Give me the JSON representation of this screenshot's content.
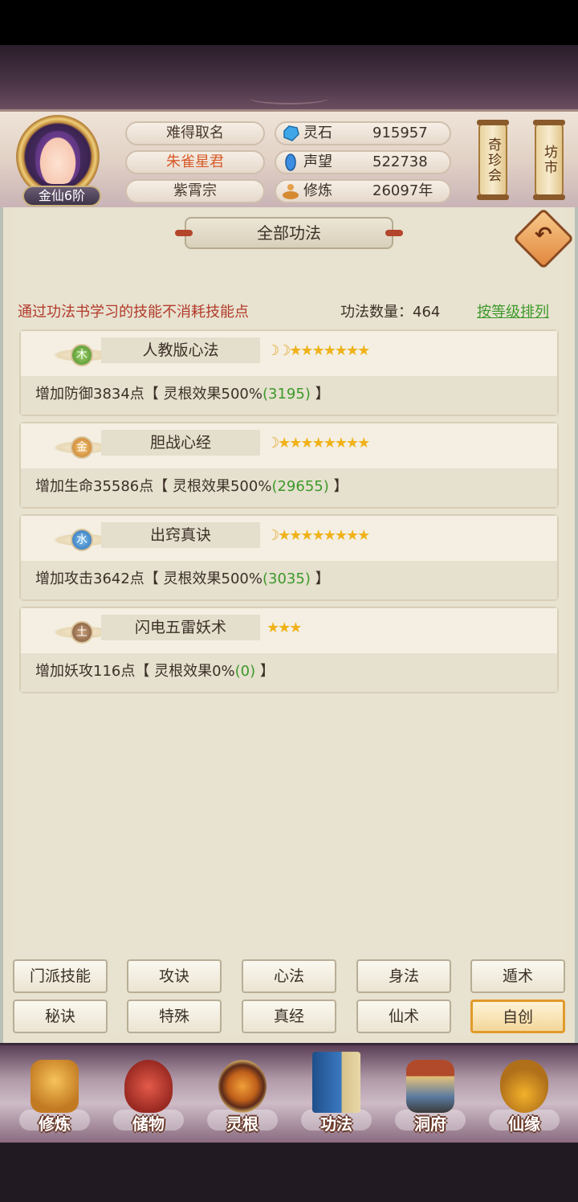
{
  "header": {
    "rank": "金仙6阶",
    "names": [
      "难得取名",
      "朱雀星君",
      "紫霄宗"
    ],
    "resources": [
      {
        "label": "灵石",
        "value": "915957",
        "icon": "spirit-stone-icon"
      },
      {
        "label": "声望",
        "value": "522738",
        "icon": "prestige-icon"
      },
      {
        "label": "修炼",
        "value": "26097年",
        "icon": "cultivation-icon"
      }
    ],
    "side_buttons": [
      "奇珍会",
      "坊市"
    ]
  },
  "panel": {
    "title": "全部功法",
    "tip": "通过功法书学习的技能不消耗技能点",
    "count": "功法数量：464",
    "sort_label": "按等级排列",
    "back_icon": "back-arrow-icon"
  },
  "skills": [
    {
      "element": "木",
      "name": "人教版心法",
      "moons": 2,
      "stars": 7,
      "effect_pre": "增加防御3834点【 灵根效果500%",
      "effect_num": "(3195)",
      "effect_post": " 】"
    },
    {
      "element": "金",
      "name": "胆战心经",
      "moons": 1,
      "stars": 8,
      "effect_pre": "增加生命35586点【 灵根效果500%",
      "effect_num": "(29655)",
      "effect_post": " 】"
    },
    {
      "element": "水",
      "name": "出窍真诀",
      "moons": 1,
      "stars": 8,
      "effect_pre": "增加攻击3642点【 灵根效果500%",
      "effect_num": "(3035)",
      "effect_post": " 】"
    },
    {
      "element": "土",
      "name": "闪电五雷妖术",
      "moons": 0,
      "stars": 3,
      "effect_pre": "增加妖攻116点【 灵根效果0%",
      "effect_num": "(0)",
      "effect_post": " 】"
    }
  ],
  "categories": {
    "row1": [
      "门派技能",
      "攻诀",
      "心法",
      "身法",
      "遁术"
    ],
    "row2": [
      "秘诀",
      "特殊",
      "真经",
      "仙术",
      "自创"
    ],
    "active": "自创"
  },
  "nav": [
    {
      "label": "修炼",
      "icon": "meditation-icon"
    },
    {
      "label": "储物",
      "icon": "storage-bag-icon"
    },
    {
      "label": "灵根",
      "icon": "spirit-root-icon"
    },
    {
      "label": "功法",
      "icon": "skill-book-icon"
    },
    {
      "label": "洞府",
      "icon": "cave-dwelling-icon"
    },
    {
      "label": "仙缘",
      "icon": "gourd-icon"
    }
  ],
  "colors": {
    "tip": "#b23a2a",
    "sort": "#3c9a2a",
    "highlight_name": "#d85b2a",
    "active_tab_border": "#e29a2a",
    "effect_value": "#3c9a2a"
  }
}
